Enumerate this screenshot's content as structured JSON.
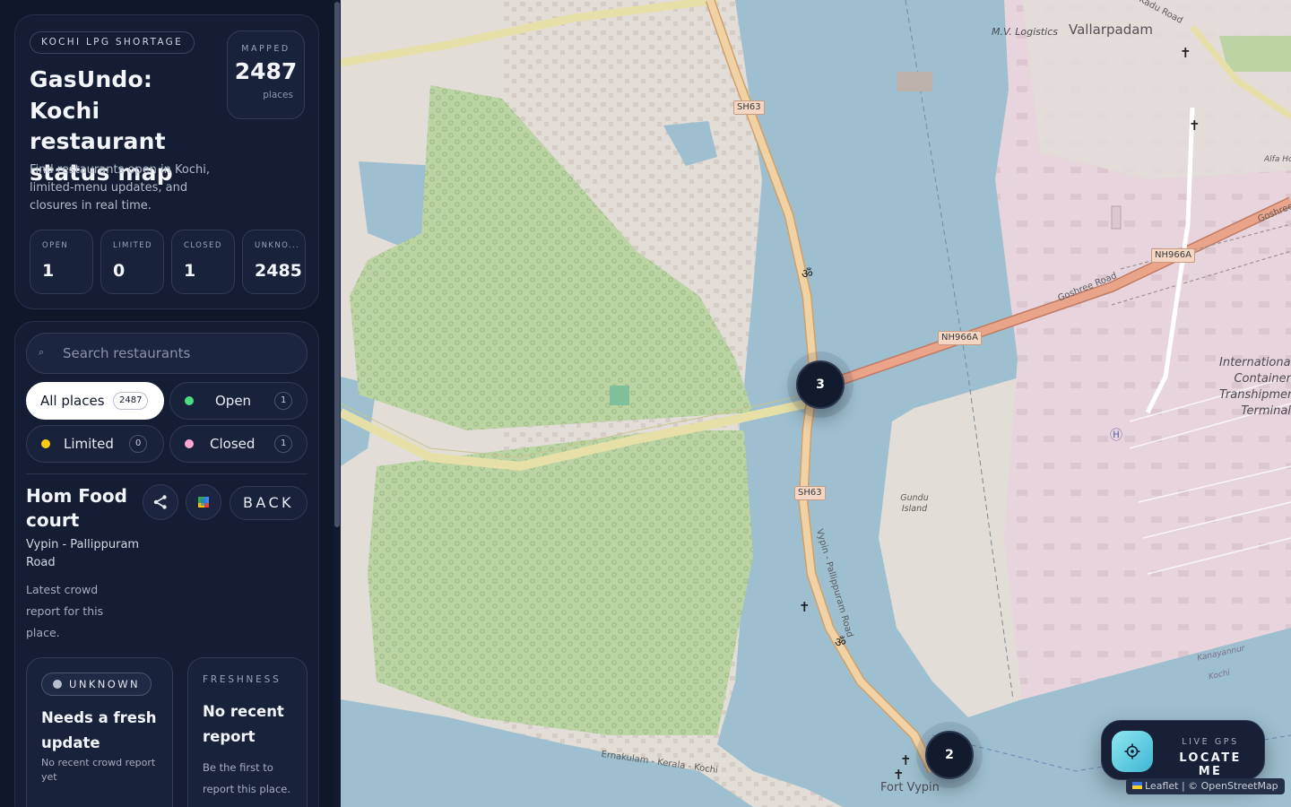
{
  "header": {
    "eyebrow": "KOCHI LPG SHORTAGE",
    "title": "GasUndo: Kochi restaurant status map",
    "subtitle": "Find restaurants open in Kochi, limited-menu updates, and closures in real time.",
    "mapped": {
      "label": "MAPPED",
      "value": "2487",
      "unit": "places"
    }
  },
  "stats": [
    {
      "label": "OPEN",
      "value": "1"
    },
    {
      "label": "LIMITED",
      "value": "0"
    },
    {
      "label": "CLOSED",
      "value": "1"
    },
    {
      "label": "UNKNO...",
      "value": "2485"
    }
  ],
  "search": {
    "placeholder": "Search restaurants",
    "value": ""
  },
  "filters": {
    "all": {
      "label": "All places",
      "count": "2487"
    },
    "open": {
      "label": "Open",
      "count": "1",
      "color": "#4ade80"
    },
    "limited": {
      "label": "Limited",
      "count": "0",
      "color": "#facc15"
    },
    "closed": {
      "label": "Closed",
      "count": "1",
      "color": "#f9a8d4"
    }
  },
  "place": {
    "name": "Hom Food court",
    "back_label": "BACK",
    "address": "Vypin - Pallippuram Road",
    "note": "Latest crowd report for this place."
  },
  "status": {
    "badge": "UNKNOWN",
    "title": "Needs a fresh update",
    "subtitle": "No recent crowd report yet"
  },
  "freshness": {
    "label": "FRESHNESS",
    "title": "No recent report",
    "subtitle": "Be the first to report this place."
  },
  "map": {
    "clusters": [
      "3",
      "2"
    ],
    "locate": {
      "top": "LIVE GPS",
      "main": "LOCATE ME"
    },
    "attribution": "Leaflet | © OpenStreetMap",
    "labels": {
      "vallarpadam": "Vallarpadam",
      "mv_logistics": "M.V. Logistics",
      "kadu_road": "Kadu Road",
      "alfa": "Alfa Ho",
      "goshree": "Goshree",
      "goshree_road": "Goshree Road",
      "nh966a_1": "NH966A",
      "nh966a_2": "NH966A",
      "sh63_1": "SH63",
      "sh63_2": "SH63",
      "gundu": "Gundu Island",
      "vypin_road": "Vypin - Pallippuram Road",
      "terminal": "International Container Transhipment Terminal",
      "fort_vypin": "Fort Vypin",
      "ernakulam": "Ernakulam - Kerala - Kochi",
      "kanayannur": "Kanayannur",
      "kochi_small": "Kochi"
    },
    "colors": {
      "water": "#9ebfd0",
      "land": "#e2ddd7",
      "mangrove": "#bcd3a4",
      "industrial": "#e7d4dc",
      "road_primary": "#f0d2a5",
      "road_trunk": "#e9a48a"
    }
  }
}
